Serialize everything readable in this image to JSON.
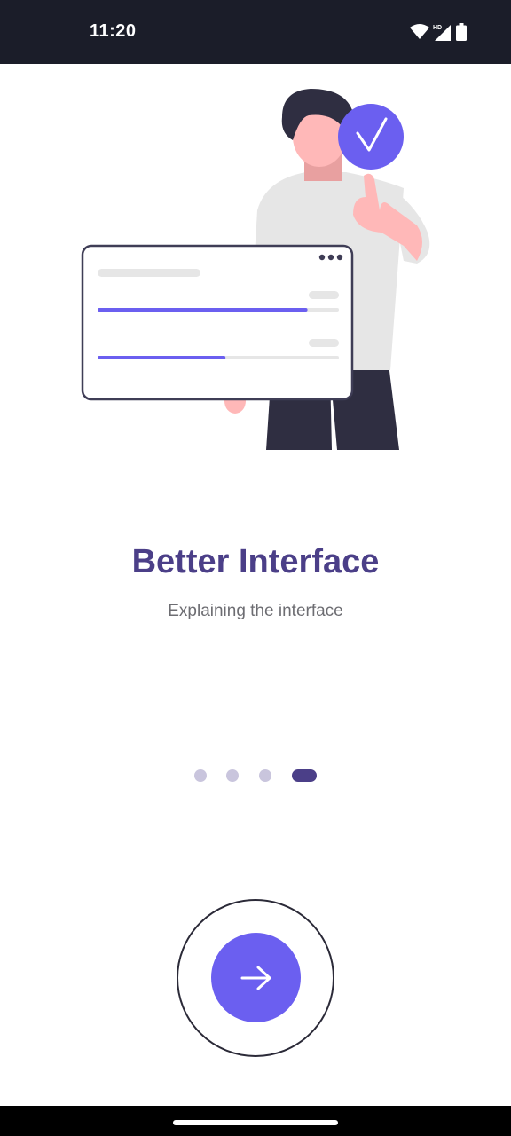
{
  "status_bar": {
    "time": "11:20",
    "icons": [
      "wifi-icon",
      "cellular-hd-icon",
      "battery-icon"
    ],
    "hd_label": "HD"
  },
  "illustration": {
    "subject": "person-thumbs-up-with-checklist-card",
    "colors": {
      "accent": "#6b5ff0",
      "hair": "#2f2e41",
      "skin": "#ffb8b8",
      "shirt": "#e6e6e6",
      "pants": "#2f2e41"
    },
    "progress_bars": [
      {
        "fraction": 0.87
      },
      {
        "fraction": 0.53
      }
    ]
  },
  "onboarding": {
    "title": "Better Interface",
    "subtitle": "Explaining the interface",
    "page_count": 4,
    "current_page": 4
  },
  "next_button": {
    "icon": "arrow-right-icon",
    "color": "#6b5ff0"
  },
  "colors": {
    "title": "#4b3f88",
    "dot_inactive": "#c9c5dd",
    "dot_active": "#4b3f88"
  }
}
